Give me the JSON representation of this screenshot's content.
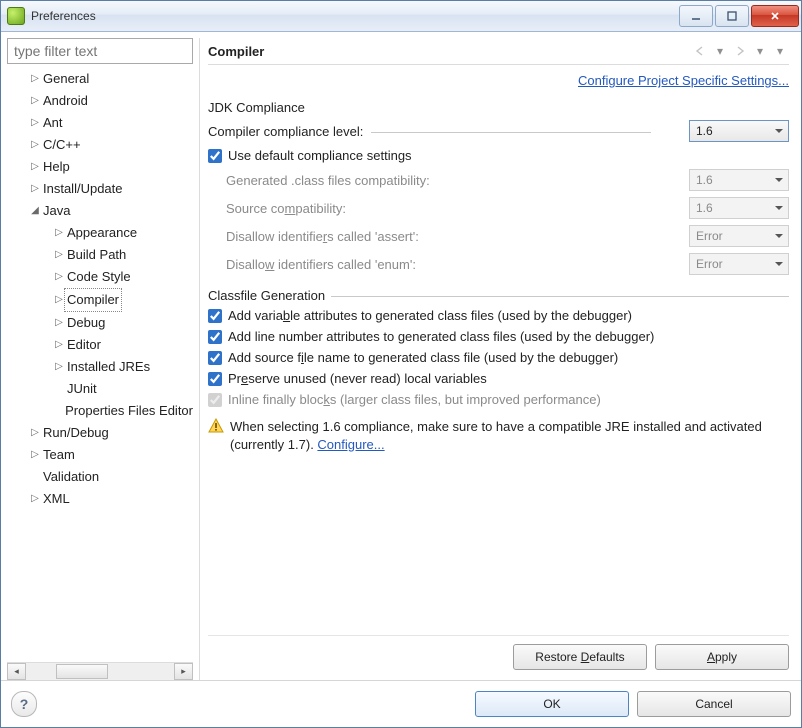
{
  "window": {
    "title": "Preferences"
  },
  "filter": {
    "placeholder": "type filter text"
  },
  "tree": [
    {
      "label": "General",
      "level": 1,
      "exp": "closed"
    },
    {
      "label": "Android",
      "level": 1,
      "exp": "closed"
    },
    {
      "label": "Ant",
      "level": 1,
      "exp": "closed"
    },
    {
      "label": "C/C++",
      "level": 1,
      "exp": "closed"
    },
    {
      "label": "Help",
      "level": 1,
      "exp": "closed"
    },
    {
      "label": "Install/Update",
      "level": 1,
      "exp": "closed"
    },
    {
      "label": "Java",
      "level": 1,
      "exp": "open"
    },
    {
      "label": "Appearance",
      "level": 2,
      "exp": "closed"
    },
    {
      "label": "Build Path",
      "level": 2,
      "exp": "closed"
    },
    {
      "label": "Code Style",
      "level": 2,
      "exp": "closed"
    },
    {
      "label": "Compiler",
      "level": 2,
      "exp": "closed",
      "selected": true
    },
    {
      "label": "Debug",
      "level": 2,
      "exp": "closed"
    },
    {
      "label": "Editor",
      "level": 2,
      "exp": "closed"
    },
    {
      "label": "Installed JREs",
      "level": 2,
      "exp": "closed"
    },
    {
      "label": "JUnit",
      "level": 2,
      "exp": "none"
    },
    {
      "label": "Properties Files Editor",
      "level": 2,
      "exp": "none"
    },
    {
      "label": "Run/Debug",
      "level": 1,
      "exp": "closed"
    },
    {
      "label": "Team",
      "level": 1,
      "exp": "closed"
    },
    {
      "label": "Validation",
      "level": 1,
      "exp": "none"
    },
    {
      "label": "XML",
      "level": 1,
      "exp": "closed"
    }
  ],
  "page": {
    "title": "Compiler",
    "config_link": "Configure Project Specific Settings..."
  },
  "jdk": {
    "group_title": "JDK Compliance",
    "compliance_label": "Compiler compliance level:",
    "compliance_value": "1.6",
    "use_default_label": "Use default compliance settings",
    "use_default_checked": true,
    "generated_label": "Generated .class files compatibility:",
    "generated_value": "1.6",
    "source_label": "Source compatibility:",
    "source_value": "1.6",
    "assert_label": "Disallow identifiers called 'assert':",
    "assert_value": "Error",
    "enum_label": "Disallow identifiers called 'enum':",
    "enum_value": "Error"
  },
  "classfile": {
    "group_title": "Classfile Generation",
    "var_attr": {
      "label": "Add variable attributes to generated class files (used by the debugger)",
      "checked": true
    },
    "line_num": {
      "label": "Add line number attributes to generated class files (used by the debugger)",
      "checked": true
    },
    "src_file": {
      "label": "Add source file name to generated class file (used by the debugger)",
      "checked": true
    },
    "preserve": {
      "label": "Preserve unused (never read) local variables",
      "checked": true
    },
    "inline": {
      "label": "Inline finally blocks (larger class files, but improved performance)",
      "checked": true
    }
  },
  "warning": {
    "text": "When selecting 1.6 compliance, make sure to have a compatible JRE installed and activated (currently 1.7). ",
    "link": "Configure..."
  },
  "buttons": {
    "restore": "Restore Defaults",
    "apply": "Apply",
    "ok": "OK",
    "cancel": "Cancel"
  }
}
